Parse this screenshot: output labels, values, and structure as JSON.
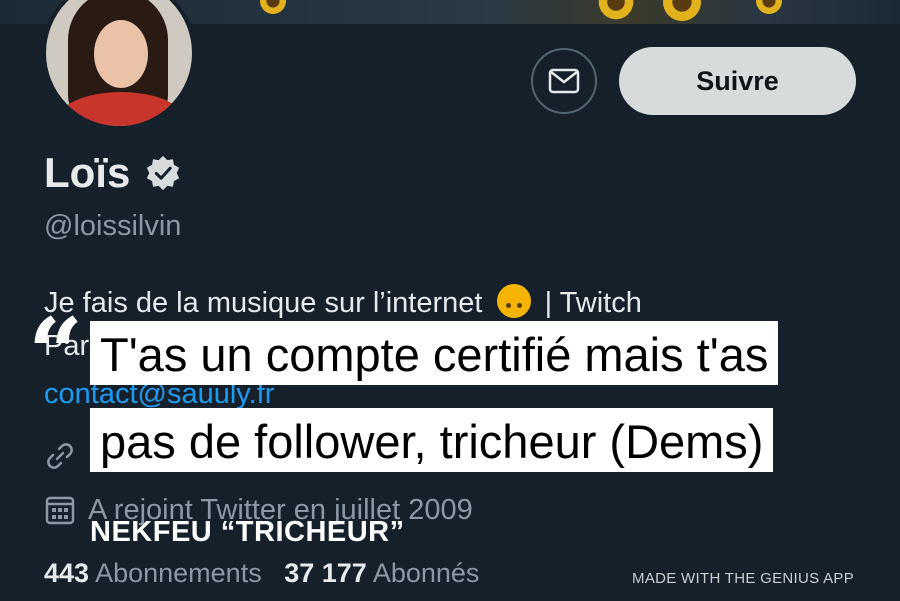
{
  "profile": {
    "name": "Loïs",
    "handle": "@loissilvin",
    "bio_line1": "Je fais de la musique sur l’internet",
    "bio_line1_suffix": "| Twitch",
    "bio_line2_visible": "Par",
    "contact": "contact@sauuly.fr",
    "joined": "A rejoint Twitter en juillet 2009",
    "follow_label": "Suivre",
    "stats": {
      "following_count": "443",
      "following_label": "Abonnements",
      "followers_count": "37 177",
      "followers_label": "Abonnés"
    }
  },
  "lyric": {
    "quote_mark": "“",
    "line1": "T'as un compte certifié mais t'as",
    "line2": "pas de follower, tricheur (Dems)",
    "song": "NEKFEU “TRICHEUR”"
  },
  "footer": {
    "credit": "MADE WITH THE GENIUS APP"
  },
  "icons": {
    "message": "envelope-icon",
    "verified": "verified-badge-icon",
    "link": "link-icon",
    "calendar": "calendar-icon",
    "bio_emoji": "upside-down-face-emoji"
  },
  "colors": {
    "background": "#15202b",
    "link": "#1d9bf0",
    "button": "#d7dbdc"
  }
}
